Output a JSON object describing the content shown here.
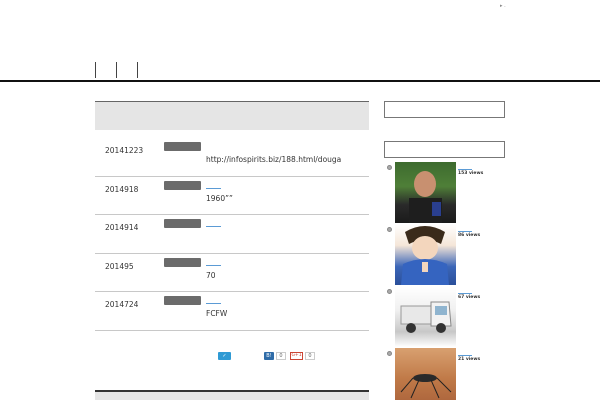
{
  "top_mark": "▸ .",
  "nav": {
    "separators": 3
  },
  "articles": [
    {
      "date": "20141223",
      "text": "http://infospirits.biz/188.html/douga",
      "has_link": false
    },
    {
      "date": "2014918",
      "text": "1960””",
      "has_link": true
    },
    {
      "date": "2014914",
      "text": "",
      "has_link": true
    },
    {
      "date": "201495",
      "text": "70",
      "has_link": true
    },
    {
      "date": "2014724",
      "text": "FCFW",
      "has_link": true
    }
  ],
  "share": {
    "twitter_label": "✓",
    "hatena_label": "B!",
    "hatena_count": "0",
    "gplus_label": "G+1",
    "gplus_count": "0"
  },
  "popular": [
    {
      "views": "153 views",
      "thumb": "baseball-coach-photo"
    },
    {
      "views": "86 views",
      "thumb": "anime-character-illustration"
    },
    {
      "views": "67 views",
      "thumb": "mini-truck-photo"
    },
    {
      "views": "21 views",
      "thumb": "mosquito-photo"
    }
  ],
  "colors": {
    "link": "#5b9bd5",
    "tag": "#6b6b6b",
    "twitter": "#2f9ad4",
    "hatena": "#2f6ca8",
    "gplus": "#cc4433"
  }
}
